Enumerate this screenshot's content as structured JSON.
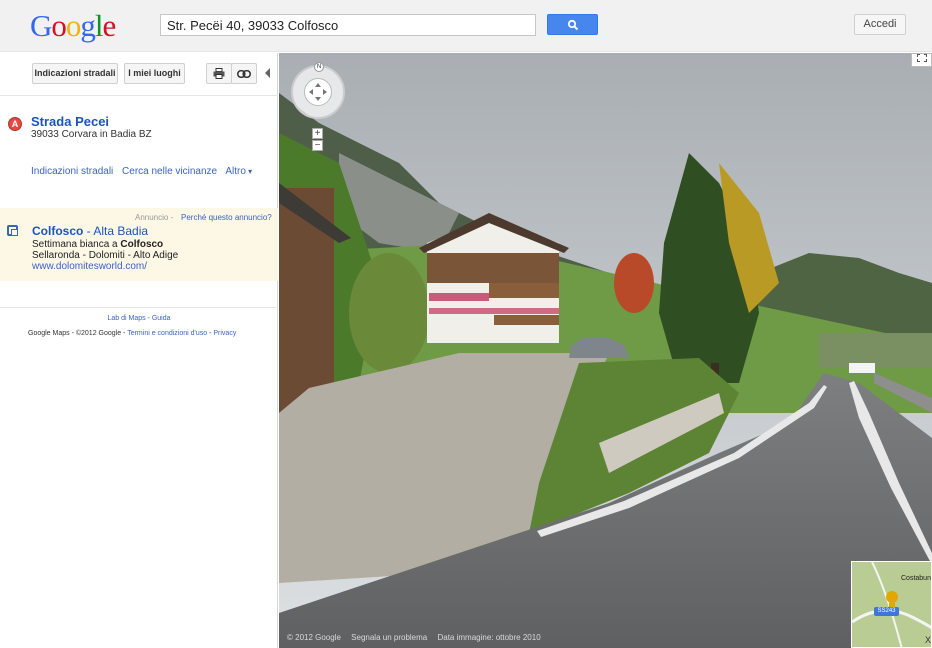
{
  "header": {
    "logo_letters": [
      "G",
      "o",
      "o",
      "g",
      "l",
      "e"
    ],
    "logo_colors": [
      "#3369e8",
      "#d50f25",
      "#eeb211",
      "#3369e8",
      "#009925",
      "#d50f25"
    ],
    "search_value": "Str. Pecëi 40, 39033 Colfosco",
    "search_icon": "search-icon",
    "signin_label": "Accedi"
  },
  "sidebar": {
    "toolbar": {
      "directions_label": "Indicazioni stradali",
      "my_places_label": "I miei luoghi",
      "print_icon": "print-icon",
      "link_icon": "link-icon"
    },
    "place": {
      "marker_letter": "A",
      "title": "Strada Pecei",
      "address": "39033 Corvara in Badia BZ",
      "links": [
        "Indicazioni stradali",
        "Cerca nelle vicinanze",
        "Altro"
      ]
    },
    "ad": {
      "label": "Annuncio",
      "why": "Perché questo annuncio?",
      "title_bold": "Colfosco",
      "title_rest": " - Alta Badia",
      "line1_pre": "Settimana bianca a ",
      "line1_bold": "Colfosco",
      "line2": "Sellaronda - Dolomiti - Alto Adige",
      "url": "www.dolomitesworld.com/"
    },
    "footer": {
      "links1": [
        "Lab di Maps",
        "Guida"
      ],
      "copyright": "Google Maps - ©2012 Google - ",
      "terms": "Termini e condizioni d'uso",
      "privacy": "Privacy"
    }
  },
  "streetview": {
    "compass_letter": "N",
    "zoom_in": "+",
    "zoom_out": "−",
    "footer": [
      "© 2012 Google",
      "Segnala un problema",
      "Data immagine: ottobre 2010"
    ],
    "minimap": {
      "place_label": "Costabun",
      "road_label": "SS243",
      "close": "X"
    }
  }
}
